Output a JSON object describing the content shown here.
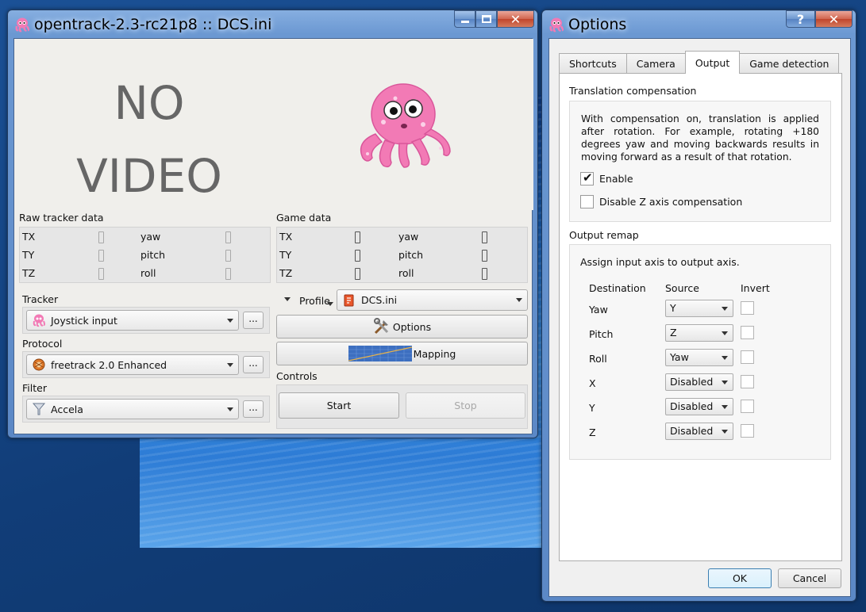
{
  "main_window": {
    "title": "opentrack-2.3-rc21p8 :: DCS.ini",
    "video_placeholder": [
      "NO",
      "VIDEO"
    ],
    "raw_tracker": {
      "label": "Raw tracker data",
      "rows": [
        {
          "a": "TX",
          "b": "yaw"
        },
        {
          "a": "TY",
          "b": "pitch"
        },
        {
          "a": "TZ",
          "b": "roll"
        }
      ]
    },
    "game_data": {
      "label": "Game data",
      "rows": [
        {
          "a": "TX",
          "b": "yaw"
        },
        {
          "a": "TY",
          "b": "pitch"
        },
        {
          "a": "TZ",
          "b": "roll"
        }
      ]
    },
    "tracker": {
      "label": "Tracker",
      "value": "Joystick input"
    },
    "protocol": {
      "label": "Protocol",
      "value": "freetrack 2.0 Enhanced"
    },
    "filter": {
      "label": "Filter",
      "value": "Accela"
    },
    "ellipsis": "...",
    "profile": {
      "label": "Profile",
      "value": "DCS.ini"
    },
    "options_button": "Options",
    "mapping_button": "Mapping",
    "controls": {
      "label": "Controls",
      "start": "Start",
      "stop": "Stop"
    }
  },
  "options_window": {
    "title": "Options",
    "help_glyph": "?",
    "tabs": [
      "Shortcuts",
      "Camera",
      "Output",
      "Game detection"
    ],
    "active_tab": "Output",
    "translation": {
      "title": "Translation compensation",
      "description": "With compensation on, translation is applied after rotation. For example, rotating +180 degrees yaw and moving backwards results in moving forward as a result of that rotation.",
      "enable": {
        "label": "Enable",
        "checked": true
      },
      "disable_z": {
        "label": "Disable Z axis compensation",
        "checked": false
      }
    },
    "remap": {
      "title": "Output remap",
      "hint": "Assign input axis to output axis.",
      "headers": {
        "destination": "Destination",
        "source": "Source",
        "invert": "Invert"
      },
      "rows": [
        {
          "dest": "Yaw",
          "source": "Y"
        },
        {
          "dest": "Pitch",
          "source": "Z"
        },
        {
          "dest": "Roll",
          "source": "Yaw"
        },
        {
          "dest": "X",
          "source": "Disabled"
        },
        {
          "dest": "Y",
          "source": "Disabled"
        },
        {
          "dest": "Z",
          "source": "Disabled"
        }
      ]
    },
    "ok": "OK",
    "cancel": "Cancel"
  },
  "colors": {
    "octopus": "#f27ab5",
    "water": "#2d7cd6",
    "desktop": "#143f7a"
  }
}
